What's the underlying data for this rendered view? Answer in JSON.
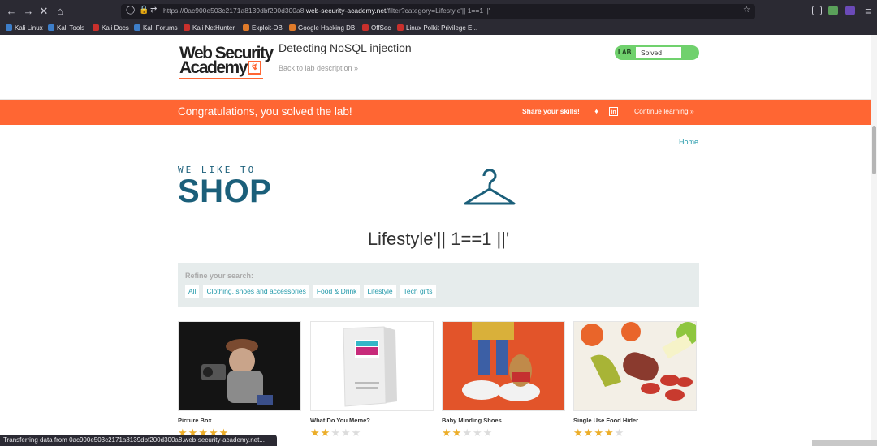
{
  "browser": {
    "url_prefix": "https://0ac900e503c2171a8139dbf200d300a8.",
    "url_domain": "web-security-academy.net",
    "url_suffix": "/filter?category=Lifestyle'|| 1==1 ||'",
    "bookmarks": [
      "Kali Linux",
      "Kali Tools",
      "Kali Docs",
      "Kali Forums",
      "Kali NetHunter",
      "Exploit-DB",
      "Google Hacking DB",
      "OffSec",
      "Linux Polkit Privilege E..."
    ],
    "status_text": "Transferring data from 0ac900e503c2171a8139dbf200d300a8.web-security-academy.net..."
  },
  "lab": {
    "logo_line1": "Web Security",
    "logo_line2": "Academy",
    "title": "Detecting NoSQL injection",
    "back_link": "Back to lab description »",
    "badge_label": "LAB",
    "status": "Solved"
  },
  "banner": {
    "message": "Congratulations, you solved the lab!",
    "share": "Share your skills!",
    "continue": "Continue learning »"
  },
  "page": {
    "home_link": "Home",
    "shop_tagline": "WE LIKE TO",
    "shop_word": "SHOP",
    "heading": "Lifestyle'|| 1==1 ||'",
    "refine_title": "Refine your search:",
    "categories": [
      "All",
      "Clothing, shoes and accessories",
      "Food & Drink",
      "Lifestyle",
      "Tech gifts"
    ]
  },
  "products": [
    {
      "name": "Picture Box",
      "rating": 5
    },
    {
      "name": "What Do You Meme?",
      "rating": 2
    },
    {
      "name": "Baby Minding Shoes",
      "rating": 2
    },
    {
      "name": "Single Use Food Hider",
      "rating": 4
    }
  ],
  "colors": {
    "accent": "#ff6633",
    "solved": "#70d16d",
    "link": "#2299aa",
    "star": "#ecae2a"
  }
}
